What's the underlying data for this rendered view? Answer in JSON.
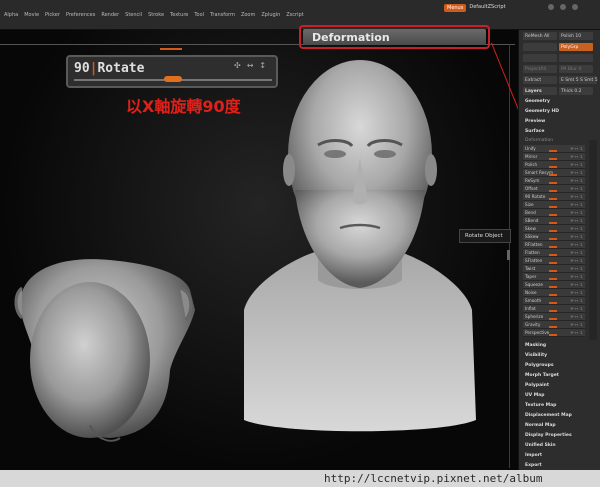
{
  "menu": {
    "items": [
      "Alpha",
      "Movie",
      "Picker",
      "Preferences",
      "Render",
      "Stencil",
      "Stroke",
      "Texture",
      "Tool",
      "Transform",
      "Zoom",
      "Zplugin",
      "Zscript"
    ],
    "menus_button": "Menus",
    "default_script": "DefaultZScript"
  },
  "popup": {
    "deformation_title": "Deformation",
    "rotate_value": "90",
    "rotate_label": "Rotate",
    "rotate_fraction": 0.5
  },
  "annotation": "以X軸旋轉90度",
  "tooltip": "Rotate Object",
  "palette": {
    "top_buttons": [
      [
        "ReMesh All",
        "Polish 10"
      ],
      [
        "",
        "PolyGrp"
      ],
      [
        "",
        ""
      ],
      [
        "ProjectAll",
        "PA Blur 4"
      ],
      [
        "Extract",
        "E Smt 5 S Smt 5"
      ],
      [
        "",
        "Thick 0.2"
      ]
    ],
    "sections": [
      "Layers",
      "Geometry",
      "Geometry HD",
      "Preview",
      "Surface"
    ],
    "deformation_header": "Deformation",
    "deform_sliders": [
      "Unify",
      "Mirror",
      "Polish",
      "Smart Resym",
      "ReSym",
      "Offset",
      "90 Rotate",
      "Size",
      "Bend",
      "SBend",
      "Skew",
      "SSkew",
      "RFlatten",
      "Flatten",
      "SFlatten",
      "Twist",
      "Taper",
      "Squeeze",
      "Noise",
      "Smooth",
      "Inflat",
      "Spherize",
      "Gravity",
      "Perspective"
    ],
    "lower_sections": [
      "Masking",
      "Visibility",
      "Polygroups",
      "Morph Target",
      "Polypaint",
      "UV Map",
      "Texture Map",
      "Displacement Map",
      "Normal Map",
      "Display Properties",
      "Unified Skin",
      "Import",
      "Export"
    ]
  },
  "footer": {
    "url": "http://lccnetvip.pixnet.net/album"
  },
  "colors": {
    "accent": "#d45a1a",
    "highlight_border": "#c8202a",
    "annotation_text": "#e0201a"
  }
}
